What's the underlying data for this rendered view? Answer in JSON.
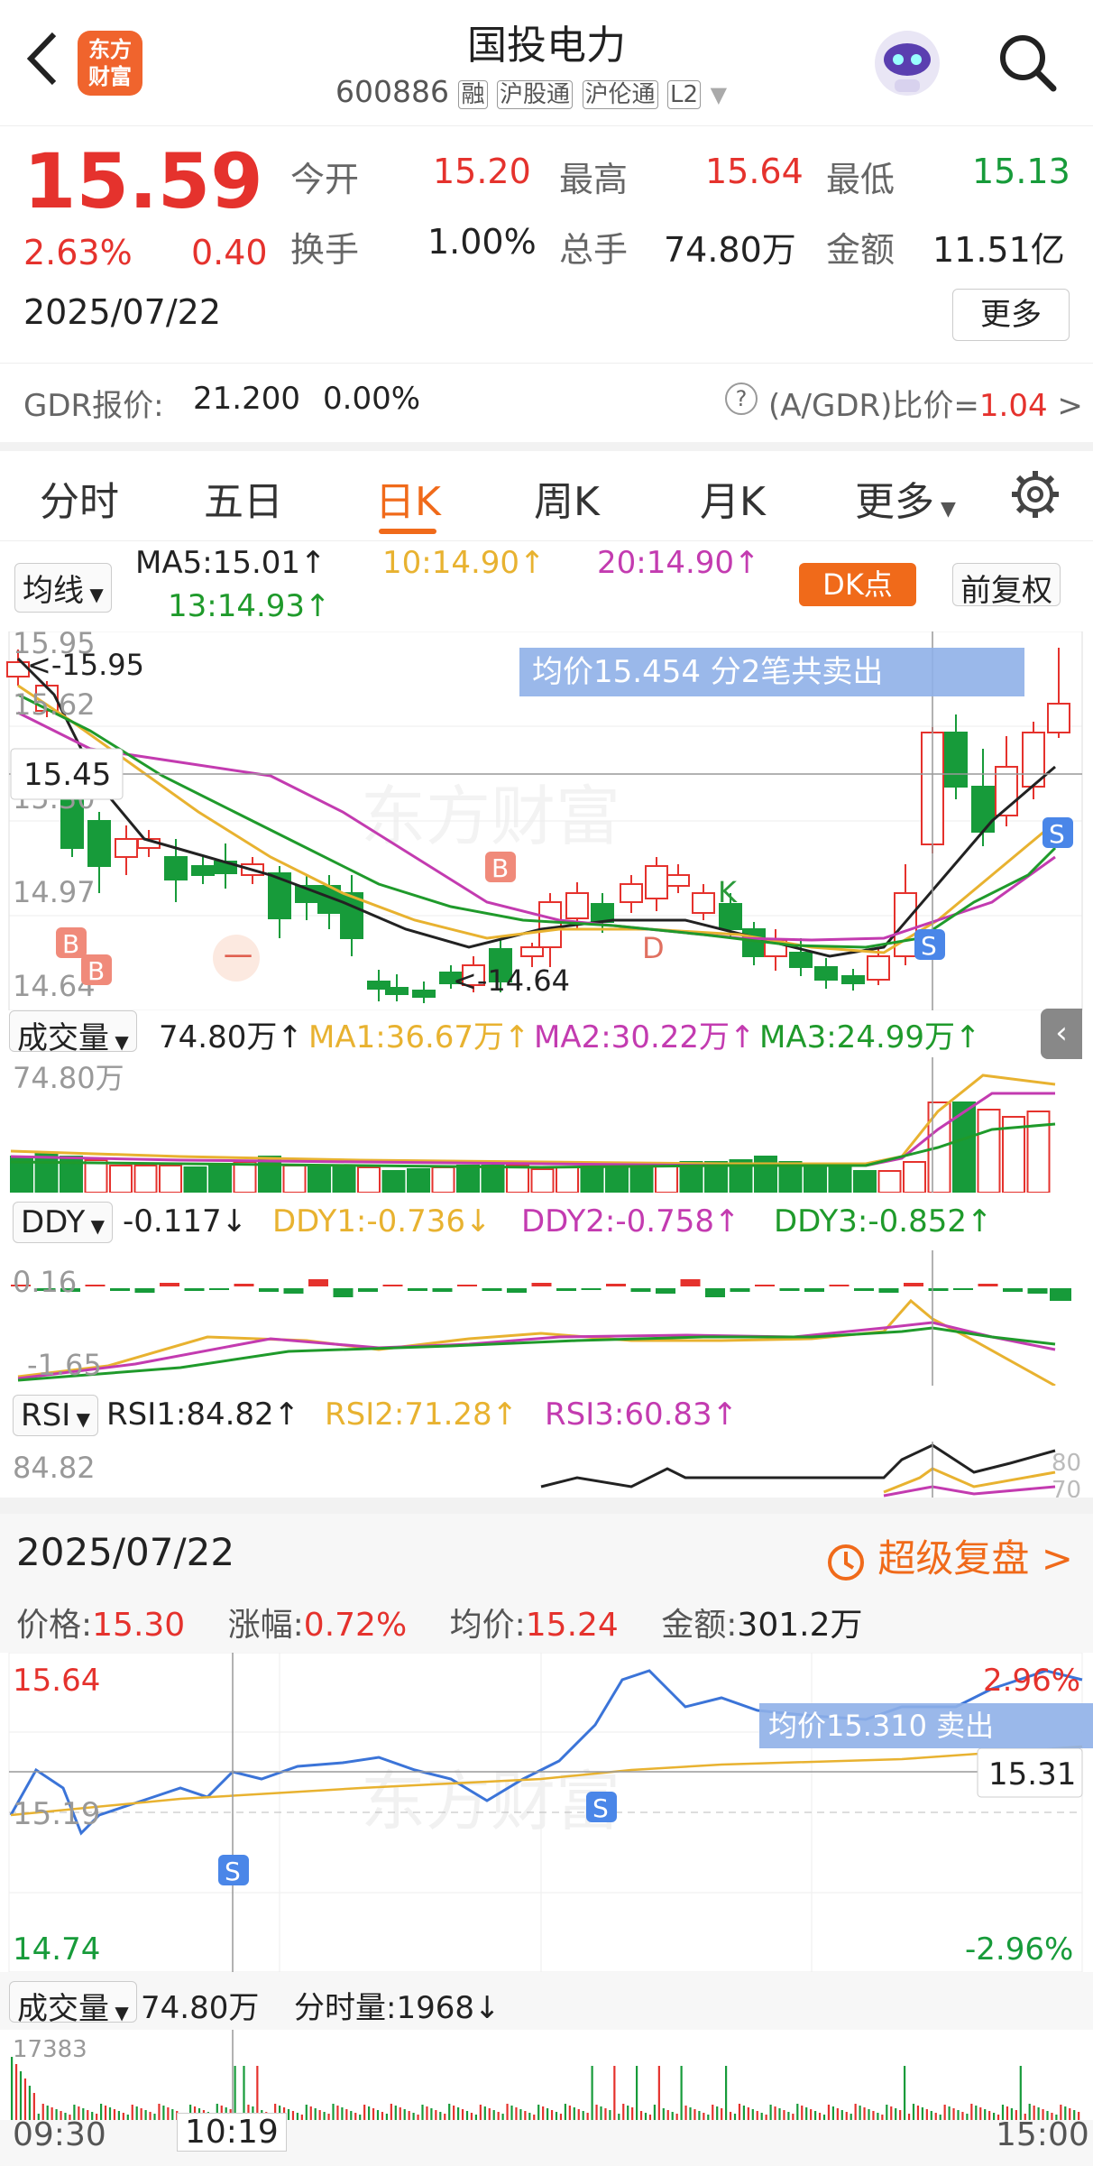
{
  "header": {
    "title": "国投电力",
    "code": "600886",
    "tags": [
      "融",
      "沪股通",
      "沪伦通",
      "L2"
    ],
    "logo_text": "东方\n财富"
  },
  "quote": {
    "price": "15.59",
    "pct": "2.63%",
    "chg": "0.40",
    "date": "2025/07/22",
    "open_label": "今开",
    "open": "15.20",
    "high_label": "最高",
    "high": "15.64",
    "low_label": "最低",
    "low": "15.13",
    "turnover_label": "换手",
    "turnover": "1.00%",
    "volume_label": "总手",
    "volume": "74.80万",
    "amount_label": "金额",
    "amount": "11.51亿",
    "more": "更多",
    "gdr_label": "GDR报价:",
    "gdr_price": "21.200",
    "gdr_pct": "0.00%",
    "ratio_label": "(A/GDR)比价=",
    "ratio_value": "1.04"
  },
  "tabs": [
    "分时",
    "五日",
    "日K",
    "周K",
    "月K",
    "更多"
  ],
  "kline": {
    "ma_label": "均线",
    "ma5": "MA5:15.01↑",
    "ma10": "10:14.90↑",
    "ma20": "20:14.90↑",
    "ma13": "13:14.93↑",
    "dk": "DK点",
    "fq": "前复权",
    "y_top": "15.95",
    "y_62": "15.62",
    "y_30": "15.30",
    "y_97": "14.97",
    "y_bottom": "14.64",
    "hi_mark": "<-15.95",
    "lo_mark": "<-14.64",
    "cursor": "15.45",
    "avg_tip": "均价15.454  分2笔共卖出",
    "marks": {
      "b": "B",
      "s": "S",
      "d": "D",
      "k": "K",
      "dash": "一"
    },
    "watermark": "东方财富"
  },
  "volume": {
    "label": "成交量",
    "value": "74.80万↑",
    "ma1": "MA1:36.67万↑",
    "ma2": "MA2:30.22万↑",
    "ma3": "MA3:24.99万↑",
    "y_max": "74.80万"
  },
  "ddy": {
    "label": "DDY",
    "value": "-0.117↓",
    "d1": "DDY1:-0.736↓",
    "d2": "DDY2:-0.758↑",
    "d3": "DDY3:-0.852↑",
    "y_top": "0.16",
    "y_bottom": "-1.65"
  },
  "rsi": {
    "label": "RSI",
    "r1": "RSI1:84.82↑",
    "r2": "RSI2:71.28↑",
    "r3": "RSI3:60.83↑",
    "y_top": "84.82",
    "y_right1": "80",
    "y_right2": "70"
  },
  "intraday": {
    "date": "2025/07/22",
    "replay": "超级复盘",
    "price_label": "价格:",
    "price": "15.30",
    "pct_label": "涨幅:",
    "pct": "0.72%",
    "avg_label": "均价:",
    "avg": "15.24",
    "amount_label": "金额:",
    "amount": "301.2万",
    "y_top": "15.64",
    "y_mid": "15.19",
    "y_bottom": "14.74",
    "pct_top": "2.96%",
    "pct_bottom": "-2.96%",
    "cursor": "15.31",
    "avg_tip": "均价15.310  卖出",
    "s": "S",
    "vol_label": "成交量",
    "vol": "74.80万",
    "fen_label": "分时量:1968↓",
    "vol_max": "17383",
    "t_start": "09:30",
    "t_cur": "10:19",
    "t_end": "15:00"
  },
  "colors": {
    "up": "#e5322d",
    "down": "#179b3a",
    "ma5": "#222222",
    "ma10": "#e8b230",
    "ma20": "#c33bb0",
    "ma13": "#1f9a2b",
    "accent": "#ff6a00",
    "blue": "#3b74d8"
  }
}
